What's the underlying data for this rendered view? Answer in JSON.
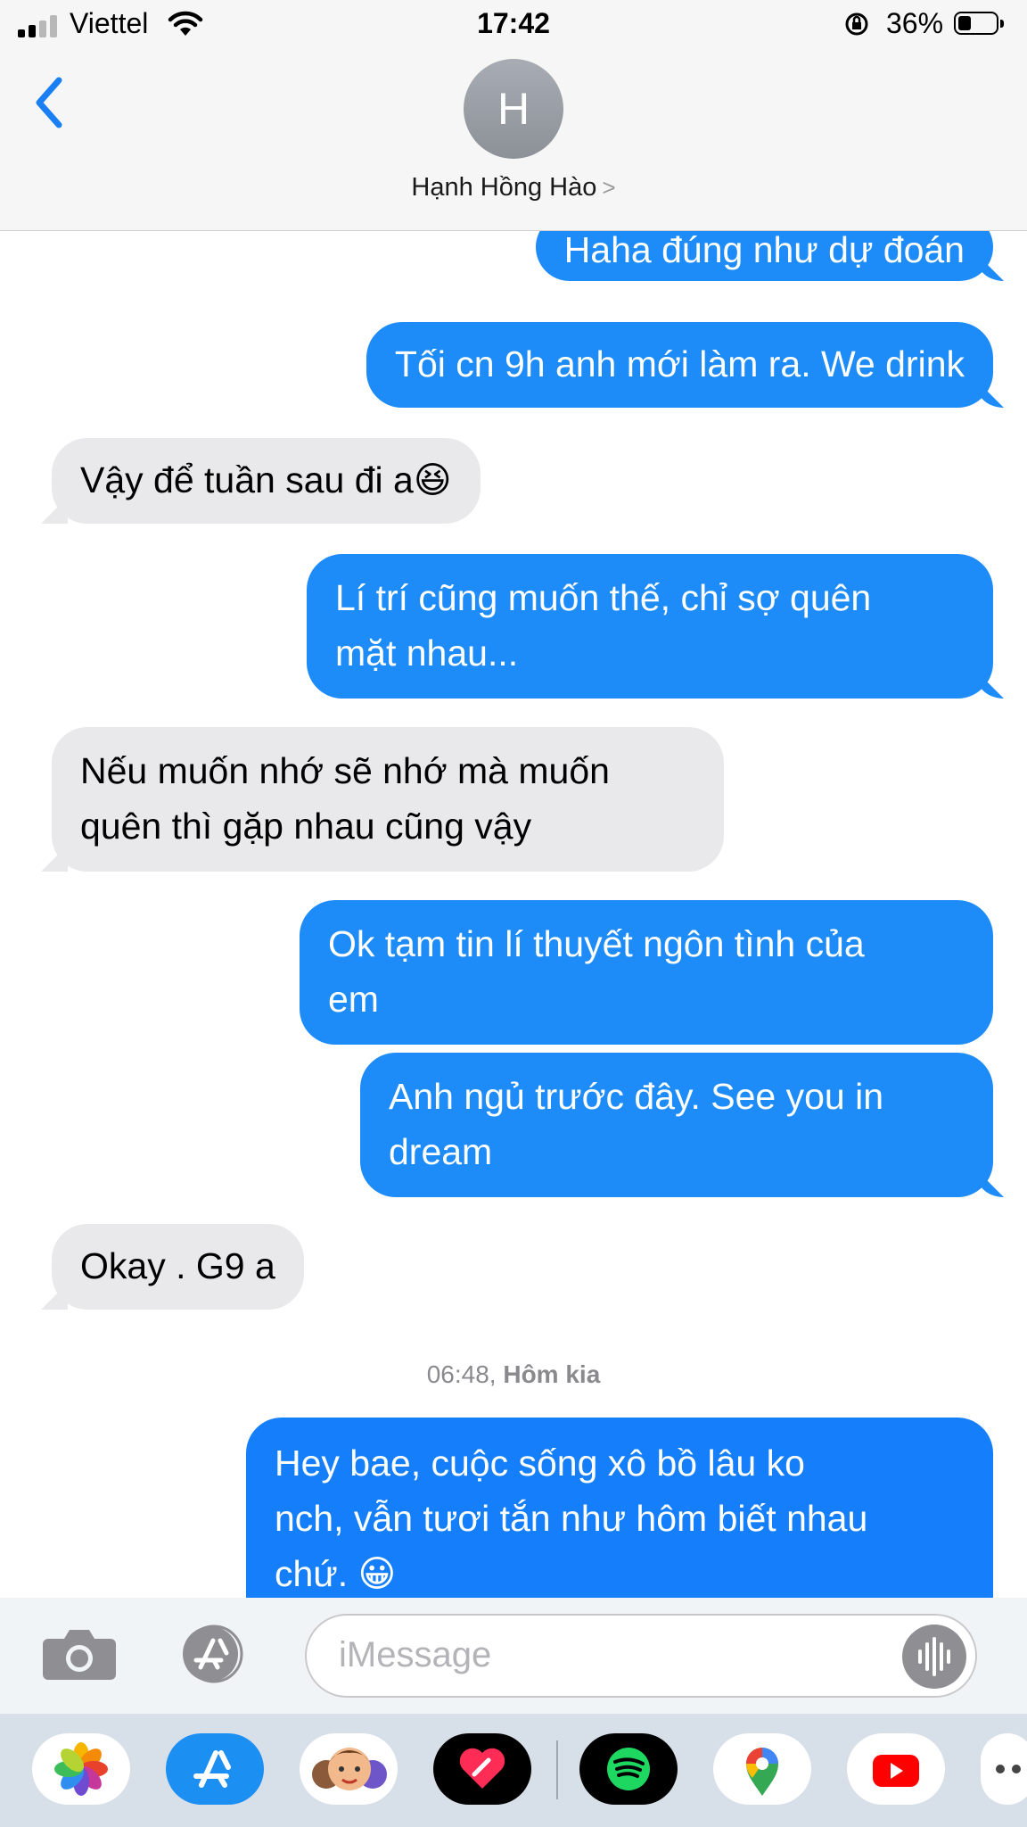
{
  "status_bar": {
    "carrier": "Viettel",
    "time": "17:42",
    "battery_percent": "36%",
    "battery_level": 0.36,
    "signal_bars": 2
  },
  "header": {
    "avatar_initial": "H",
    "contact_name": "Hạnh Hồng Hào",
    "back_icon": "chevron-left-icon"
  },
  "messages": [
    {
      "dir": "out",
      "lines": [
        "Haha đúng như dự đoán"
      ]
    },
    {
      "dir": "out",
      "lines": [
        "Tối cn 9h anh mới làm ra. We drink"
      ]
    },
    {
      "dir": "in",
      "lines": [
        "Vậy để tuần sau đi a😆"
      ]
    },
    {
      "dir": "out",
      "lines": [
        "Lí trí cũng muốn thế, chỉ sợ quên",
        "mặt nhau..."
      ]
    },
    {
      "dir": "in",
      "lines": [
        "Nếu muốn nhớ sẽ nhớ mà muốn",
        "quên thì gặp nhau cũng vậy"
      ]
    },
    {
      "dir": "out",
      "lines": [
        "Ok tạm tin lí thuyết ngôn tình của",
        "em"
      ]
    },
    {
      "dir": "out",
      "lines": [
        "Anh ngủ trước đây. See you in",
        "dream"
      ]
    },
    {
      "dir": "in",
      "lines": [
        "Okay . G9 a"
      ]
    },
    {
      "dir": "out",
      "lines": [
        "Hey bae, cuộc sống xô bồ lâu ko",
        "nch, vẫn tươi tắn như hôm biết nhau",
        "chứ. 😀"
      ]
    }
  ],
  "timestamp": {
    "time": "06:48,",
    "day": "Hôm kia"
  },
  "composer": {
    "placeholder": "iMessage",
    "camera_icon": "camera-icon",
    "apps_icon": "app-store-icon",
    "audio_icon": "waveform-icon"
  },
  "app_drawer": [
    {
      "name": "photos-app-icon"
    },
    {
      "name": "app-store-app-icon"
    },
    {
      "name": "memoji-app-icon"
    },
    {
      "name": "digital-touch-app-icon"
    },
    {
      "name": "spotify-app-icon"
    },
    {
      "name": "google-maps-app-icon"
    },
    {
      "name": "youtube-app-icon"
    },
    {
      "name": "more-apps-icon"
    }
  ],
  "colors": {
    "outgoing_bubble": "#1d8bf8",
    "incoming_bubble": "#e9e9eb",
    "accent": "#1a7ff4"
  }
}
